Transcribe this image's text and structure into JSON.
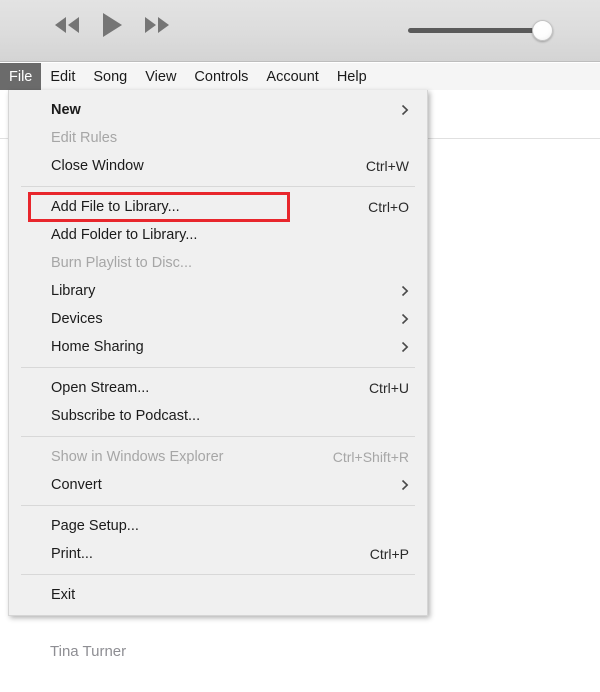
{
  "toolbar": {
    "rewind_label": "Rewind",
    "play_label": "Play",
    "fast_forward_label": "Fast Forward",
    "volume_label": "Volume"
  },
  "menubar": {
    "items": [
      {
        "label": "File",
        "active": true
      },
      {
        "label": "Edit",
        "active": false
      },
      {
        "label": "Song",
        "active": false
      },
      {
        "label": "View",
        "active": false
      },
      {
        "label": "Controls",
        "active": false
      },
      {
        "label": "Account",
        "active": false
      },
      {
        "label": "Help",
        "active": false
      }
    ]
  },
  "file_menu": {
    "items": [
      {
        "type": "item",
        "label": "New",
        "shortcut": "",
        "submenu": true,
        "disabled": false,
        "bold": true,
        "highlighted": false
      },
      {
        "type": "item",
        "label": "Edit Rules",
        "shortcut": "",
        "submenu": false,
        "disabled": true,
        "bold": false,
        "highlighted": false
      },
      {
        "type": "item",
        "label": "Close Window",
        "shortcut": "Ctrl+W",
        "submenu": false,
        "disabled": false,
        "bold": false,
        "highlighted": false
      },
      {
        "type": "separator"
      },
      {
        "type": "item",
        "label": "Add File to Library...",
        "shortcut": "Ctrl+O",
        "submenu": false,
        "disabled": false,
        "bold": false,
        "highlighted": true
      },
      {
        "type": "item",
        "label": "Add Folder to Library...",
        "shortcut": "",
        "submenu": false,
        "disabled": false,
        "bold": false,
        "highlighted": false
      },
      {
        "type": "item",
        "label": "Burn Playlist to Disc...",
        "shortcut": "",
        "submenu": false,
        "disabled": true,
        "bold": false,
        "highlighted": false
      },
      {
        "type": "item",
        "label": "Library",
        "shortcut": "",
        "submenu": true,
        "disabled": false,
        "bold": false,
        "highlighted": false
      },
      {
        "type": "item",
        "label": "Devices",
        "shortcut": "",
        "submenu": true,
        "disabled": false,
        "bold": false,
        "highlighted": false
      },
      {
        "type": "item",
        "label": "Home Sharing",
        "shortcut": "",
        "submenu": true,
        "disabled": false,
        "bold": false,
        "highlighted": false
      },
      {
        "type": "separator"
      },
      {
        "type": "item",
        "label": "Open Stream...",
        "shortcut": "Ctrl+U",
        "submenu": false,
        "disabled": false,
        "bold": false,
        "highlighted": false
      },
      {
        "type": "item",
        "label": "Subscribe to Podcast...",
        "shortcut": "",
        "submenu": false,
        "disabled": false,
        "bold": false,
        "highlighted": false
      },
      {
        "type": "separator"
      },
      {
        "type": "item",
        "label": "Show in Windows Explorer",
        "shortcut": "Ctrl+Shift+R",
        "submenu": false,
        "disabled": true,
        "bold": false,
        "highlighted": false
      },
      {
        "type": "item",
        "label": "Convert",
        "shortcut": "",
        "submenu": true,
        "disabled": false,
        "bold": false,
        "highlighted": false
      },
      {
        "type": "separator"
      },
      {
        "type": "item",
        "label": "Page Setup...",
        "shortcut": "",
        "submenu": false,
        "disabled": false,
        "bold": false,
        "highlighted": false
      },
      {
        "type": "item",
        "label": "Print...",
        "shortcut": "Ctrl+P",
        "submenu": false,
        "disabled": false,
        "bold": false,
        "highlighted": false
      },
      {
        "type": "separator"
      },
      {
        "type": "item",
        "label": "Exit",
        "shortcut": "",
        "submenu": false,
        "disabled": false,
        "bold": false,
        "highlighted": false
      }
    ]
  },
  "background": {
    "artist_text": "Tina Turner"
  },
  "colors": {
    "highlight_red": "#e8262c",
    "menubar_active_bg": "#6b6b6b",
    "menu_bg": "#f0f0f0",
    "toolbar_bg": "#dcdcdc",
    "disabled_text": "#a6a6a6"
  }
}
